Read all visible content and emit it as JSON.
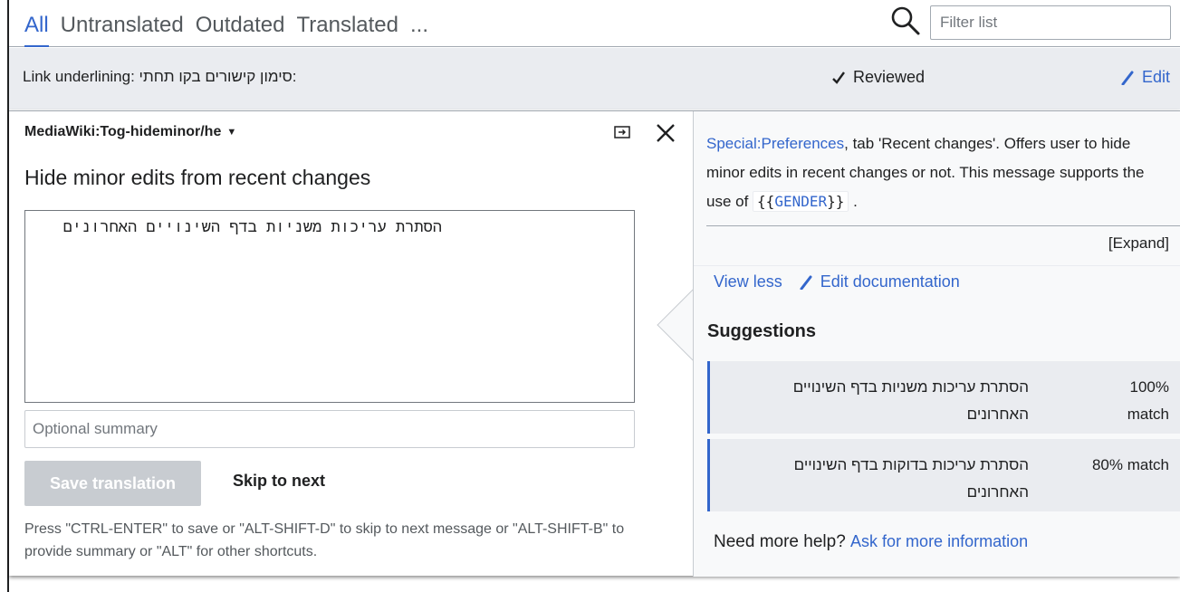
{
  "tabs": [
    {
      "label": "All",
      "active": true
    },
    {
      "label": "Untranslated",
      "active": false
    },
    {
      "label": "Outdated",
      "active": false
    },
    {
      "label": "Translated",
      "active": false
    },
    {
      "label": "...",
      "active": false
    }
  ],
  "filter": {
    "placeholder": "Filter list"
  },
  "previous_row": {
    "source": "Link underlining: סימון קישורים בקו תחתי:",
    "status": "Reviewed",
    "edit_label": "Edit"
  },
  "editor": {
    "message_key": "MediaWiki:Tog-hideminor/he",
    "source_text": "Hide minor edits from recent changes",
    "translation_text": "הסתרת עריכות משניות בדף השינויים האחרונים",
    "summary_placeholder": "Optional summary",
    "save_label": "Save translation",
    "skip_label": "Skip to next",
    "shortcut_help": "Press \"CTRL-ENTER\" to save or \"ALT-SHIFT-D\" to skip to next message or \"ALT-SHIFT-B\" to provide summary or \"ALT\" for other shortcuts."
  },
  "documentation": {
    "link_text": "Special:Preferences",
    "text_part1": ", tab 'Recent changes'. Offers user to hide minor edits in recent changes or not. This message supports the use of ",
    "code_open": "{{",
    "code_var": "GENDER",
    "code_close": "}}",
    "text_part2": " .",
    "expand_label": "[Expand]",
    "view_less_label": "View less",
    "edit_doc_label": "Edit documentation"
  },
  "suggestions": {
    "heading": "Suggestions",
    "items": [
      {
        "text": "הסתרת עריכות משניות בדף השינויים האחרונים",
        "match": "100% match"
      },
      {
        "text": "הסתרת עריכות בדוקות בדף השינויים האחרונים",
        "match": "80% match"
      }
    ]
  },
  "help": {
    "prefix": "Need more help?",
    "link": "Ask for more information"
  },
  "colors": {
    "accent": "#3366cc",
    "disabled": "#c8ccd1",
    "panel": "#f8f9fa",
    "row": "#eaecf0"
  }
}
